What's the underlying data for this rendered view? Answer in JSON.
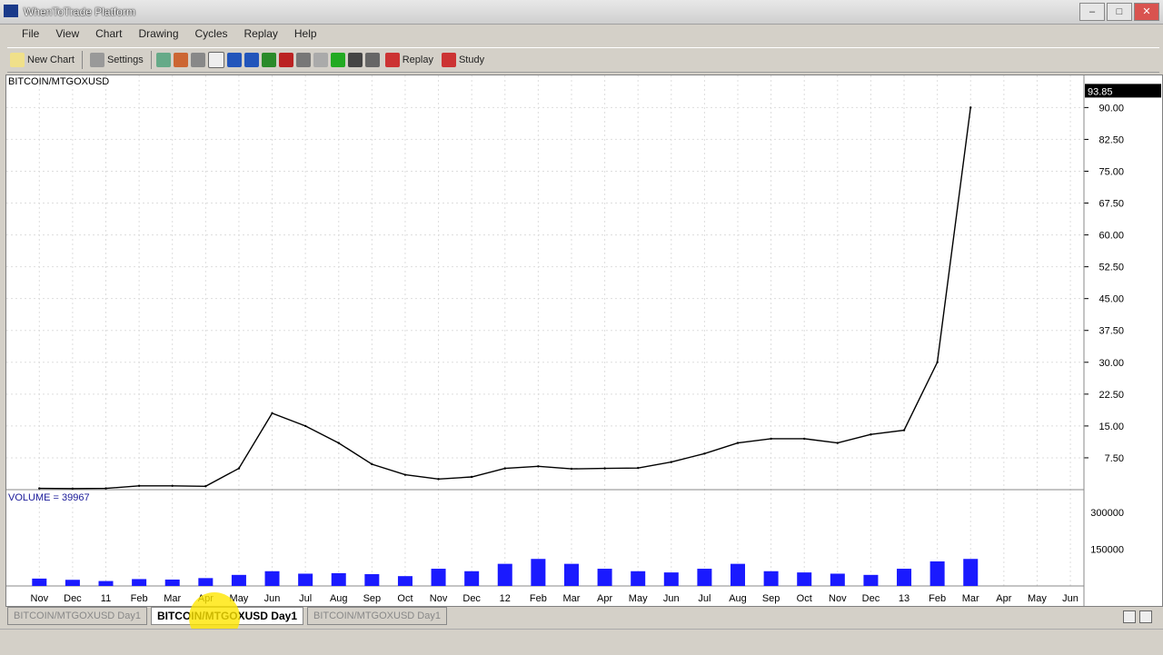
{
  "window": {
    "title": "WhenToTrade Platform"
  },
  "menu": [
    "File",
    "View",
    "Chart",
    "Drawing",
    "Cycles",
    "Replay",
    "Help"
  ],
  "toolbar": {
    "new_chart": "New Chart",
    "settings": "Settings",
    "replay": "Replay",
    "study": "Study"
  },
  "tabs": [
    "BITCOIN/MTGOXUSD Day1",
    "BITCOIN/MTGOXUSD Day1",
    "BITCOIN/MTGOXUSD Day1"
  ],
  "active_tab": 1,
  "chart": {
    "symbol": "BITCOIN/MTGOXUSD",
    "last_price": "93.85",
    "volume_label": "VOLUME = 39967",
    "price_ticks": [
      "90.00",
      "82.50",
      "75.00",
      "67.50",
      "60.00",
      "52.50",
      "45.00",
      "37.50",
      "30.00",
      "22.50",
      "15.00",
      "7.50"
    ],
    "volume_ticks": [
      "300000",
      "150000"
    ],
    "x_labels": [
      "Nov",
      "Dec",
      "11",
      "Feb",
      "Mar",
      "Apr",
      "May",
      "Jun",
      "Jul",
      "Aug",
      "Sep",
      "Oct",
      "Nov",
      "Dec",
      "12",
      "Feb",
      "Mar",
      "Apr",
      "May",
      "Jun",
      "Jul",
      "Aug",
      "Sep",
      "Oct",
      "Nov",
      "Dec",
      "13",
      "Feb",
      "Mar",
      "Apr",
      "May",
      "Jun"
    ],
    "colors": {
      "price": "#000000",
      "volume": "#1a1aff",
      "price_box": "#000000"
    }
  },
  "chart_data": {
    "type": "line",
    "title": "BITCOIN/MTGOXUSD",
    "x": [
      "Nov",
      "Dec",
      "11",
      "Feb",
      "Mar",
      "Apr",
      "May",
      "Jun",
      "Jul",
      "Aug",
      "Sep",
      "Oct",
      "Nov",
      "Dec",
      "12",
      "Feb",
      "Mar",
      "Apr",
      "May",
      "Jun",
      "Jul",
      "Aug",
      "Sep",
      "Oct",
      "Nov",
      "Dec",
      "13",
      "Feb",
      "Mar"
    ],
    "series": [
      {
        "values": [
          0.3,
          0.25,
          0.3,
          0.9,
          0.9,
          0.8,
          5,
          18,
          15,
          11,
          6,
          3.5,
          2.5,
          3,
          5,
          5.5,
          4.9,
          5,
          5.1,
          6.5,
          8.5,
          11,
          12,
          12,
          11,
          13,
          14,
          30,
          90
        ]
      }
    ],
    "ylim": [
      0,
      95
    ],
    "volume": [
      30000,
      25000,
      20000,
      28000,
      26000,
      32000,
      45000,
      60000,
      50000,
      52000,
      48000,
      40000,
      70000,
      60000,
      90000,
      110000,
      90000,
      70000,
      60000,
      55000,
      70000,
      90000,
      60000,
      55000,
      50000,
      45000,
      70000,
      100000,
      110000
    ]
  }
}
